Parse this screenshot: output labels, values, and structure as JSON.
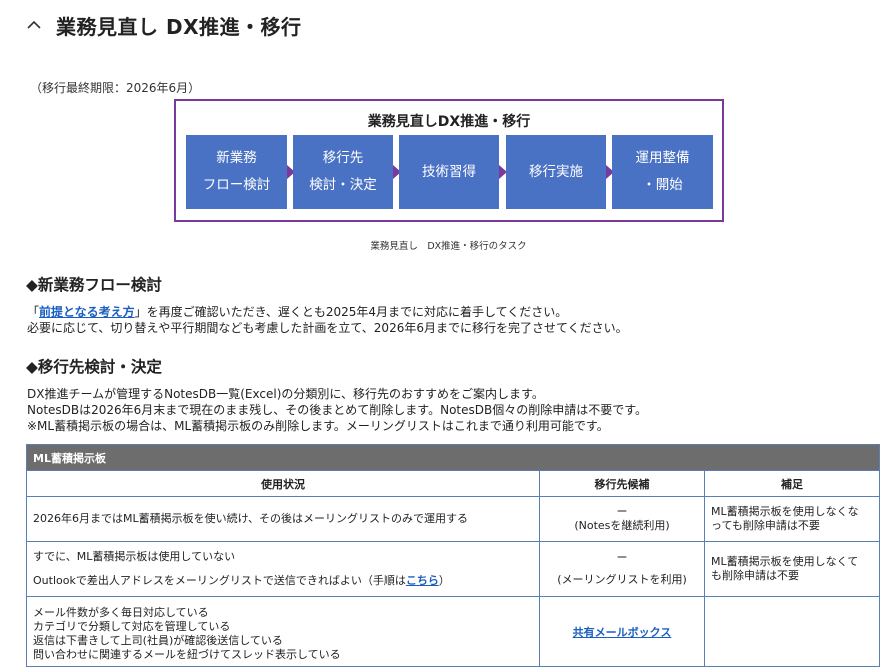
{
  "header": {
    "title": "業務見直し DX推進・移行"
  },
  "deadline": "（移行最終期限：2026年6月）",
  "diagram": {
    "title": "業務見直しDX推進・移行",
    "steps": [
      {
        "line1": "新業務",
        "line2": "フロー検討"
      },
      {
        "line1": "移行先",
        "line2": "検討・決定"
      },
      {
        "line1": "技術習得",
        "line2": ""
      },
      {
        "line1": "移行実施",
        "line2": ""
      },
      {
        "line1": "運用整備",
        "line2": "・開始"
      }
    ],
    "caption": "業務見直し　DX推進・移行のタスク"
  },
  "section1": {
    "heading": "◆新業務フロー検討",
    "line1_pre": "「",
    "line1_link": "前提となる考え方",
    "line1_post": "」を再度ご確認いただき、遅くとも2025年4月までに対応に着手してください。",
    "line2": "必要に応じて、切り替えや平行期間なども考慮した計画を立て、2026年6月までに移行を完了させてください。"
  },
  "section2": {
    "heading": "◆移行先検討・決定",
    "line1": "DX推進チームが管理するNotesDB一覧(Excel)の分類別に、移行先のおすすめをご案内します。",
    "line2": "NotesDBは2026年6月末まで現在のまま残し、その後まとめて削除します。NotesDB個々の削除申請は不要です。",
    "line3": "※ML蓄積掲示板の場合は、ML蓄積掲示板のみ削除します。メーリングリストはこれまで通り利用可能です。"
  },
  "table": {
    "title": "ML蓄積掲示板",
    "headers": [
      "使用状況",
      "移行先候補",
      "補足"
    ],
    "rows": [
      {
        "status": [
          "2026年6月まではML蓄積掲示板を使い続け、その後はメーリングリストのみで運用する"
        ],
        "candidate": [
          "ー",
          "(Notesを継続利用)"
        ],
        "note": [
          "ML蓄積掲示板を使用しなくな",
          "っても削除申請は不要"
        ]
      },
      {
        "status": [
          "すでに、ML蓄積掲示板は使用していない"
        ],
        "status2_pre": "Outlookで差出人アドレスをメーリングリストで送信できればよい（手順は",
        "status2_link": "こちら",
        "status2_post": "）",
        "candidate": [
          "ー",
          "(メーリングリストを利用)"
        ],
        "note": [
          "ML蓄積掲示板を使用しなくて",
          "も削除申請は不要"
        ]
      },
      {
        "status": [
          "メール件数が多く毎日対応している",
          "カテゴリで分類して対応を管理している",
          "返信は下書きして上司(社員)が確認後送信している",
          "問い合わせに関連するメールを紐づけてスレッド表示している"
        ],
        "candidate_link": "共有メールボックス",
        "note": []
      }
    ]
  }
}
